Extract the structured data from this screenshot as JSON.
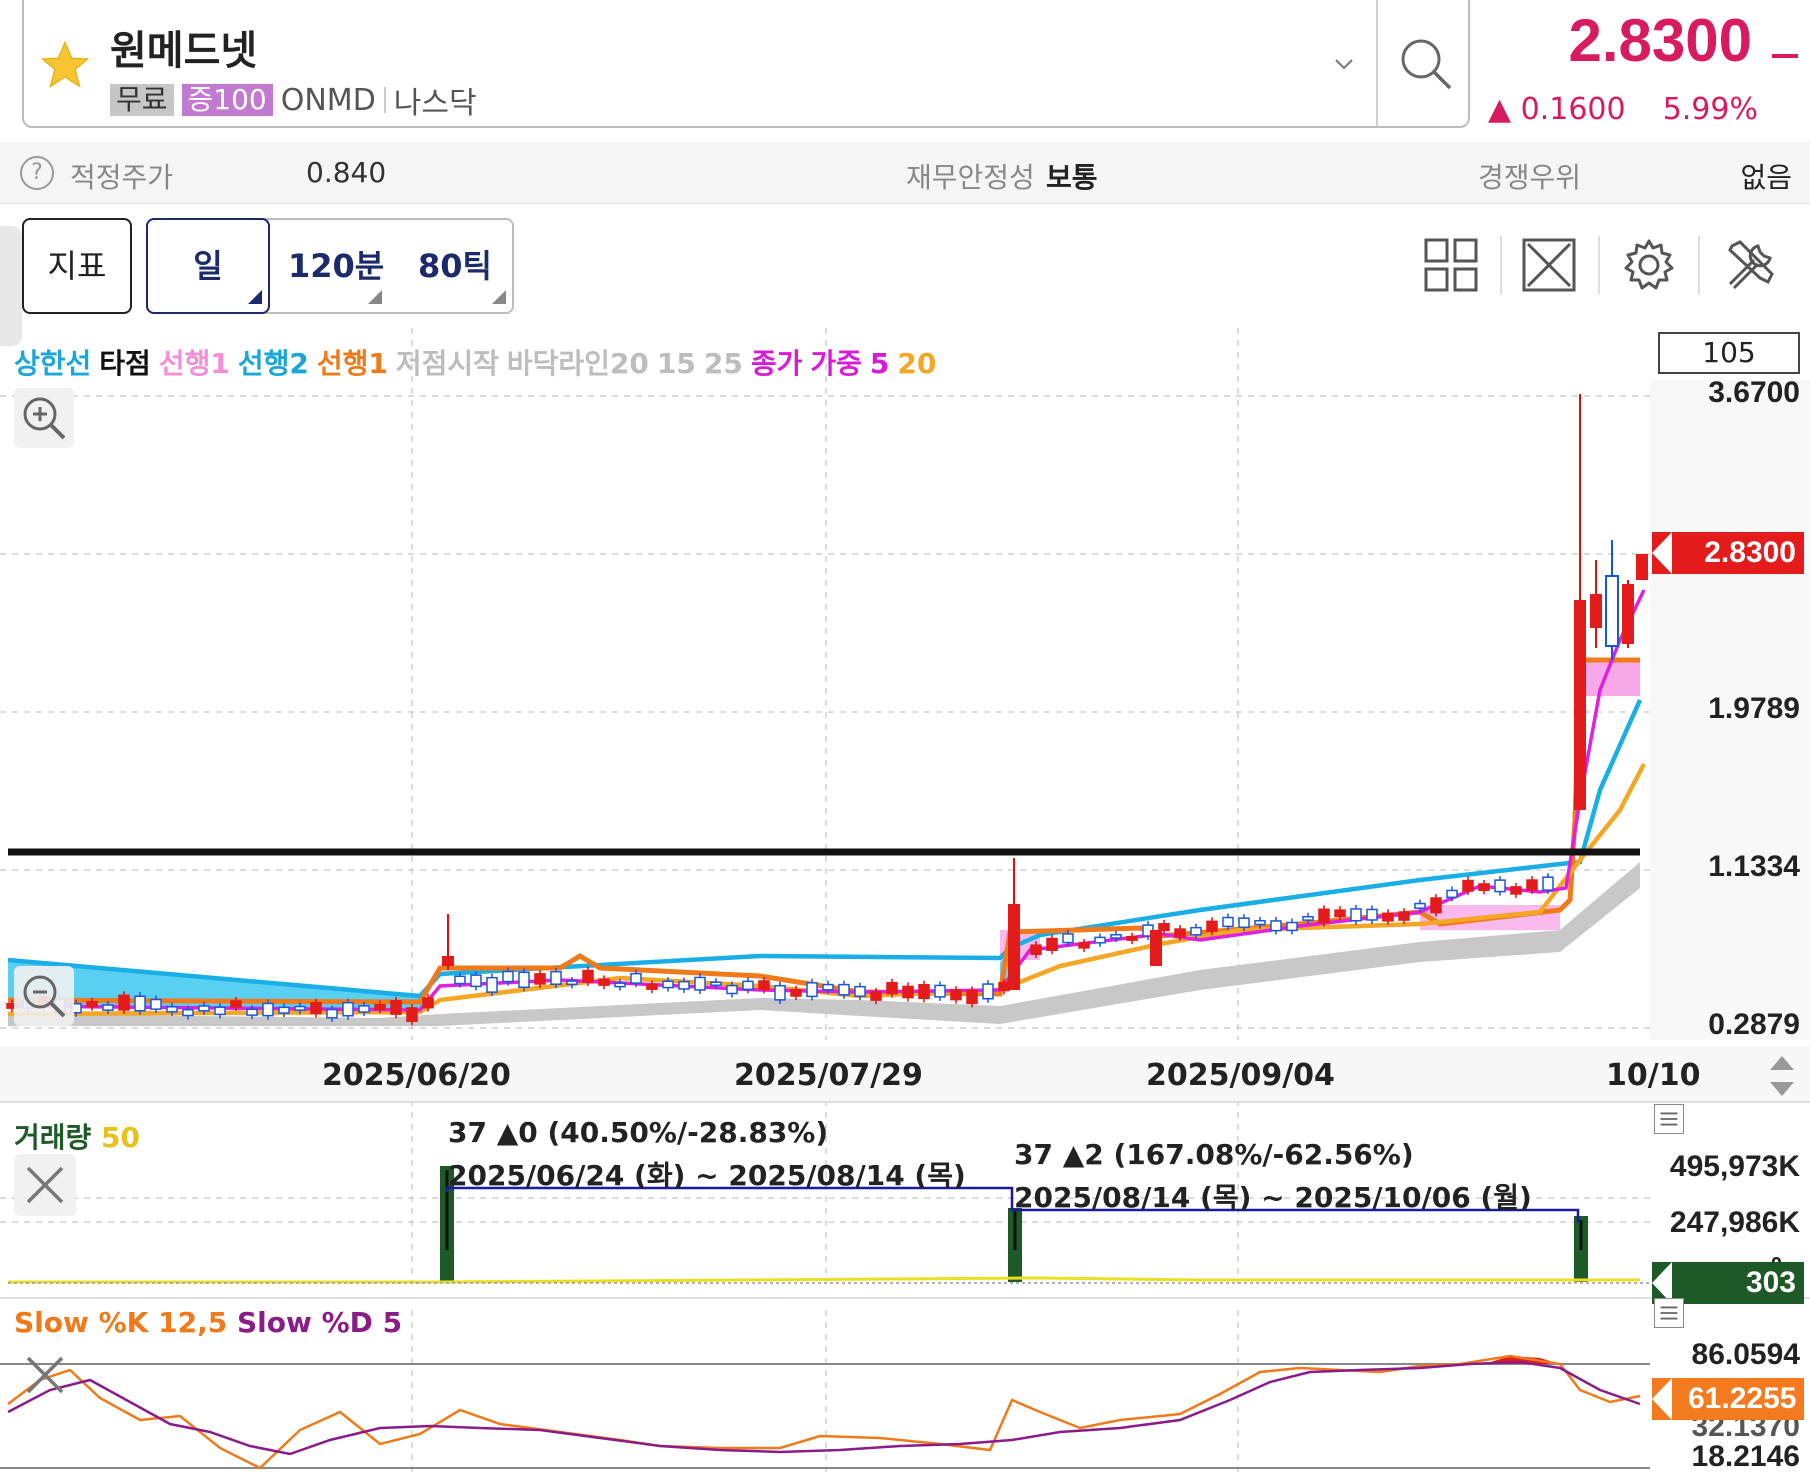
{
  "header": {
    "stock_name": "원메드넷",
    "tag_free": "무료",
    "tag_margin": "증100",
    "ticker": "ONMD",
    "market": "나스닥",
    "price": "2.8300",
    "change": "0.1600",
    "change_pct": "5.99%",
    "accent": "#d81b60"
  },
  "info": {
    "help": "?",
    "fair_price_label": "적정주가",
    "fair_price_value": "0.840",
    "stability_label": "재무안정성",
    "stability_value": "보통",
    "competition_label": "경쟁우위",
    "competition_value": "없음"
  },
  "toolbar": {
    "indicator_label": "지표",
    "timeframes": [
      "일",
      "120분",
      "80틱"
    ],
    "icons": [
      "layout-grid-icon",
      "fullscreen-icon",
      "settings-icon",
      "tools-icon"
    ]
  },
  "chart": {
    "legend": [
      {
        "text": "상한선",
        "color": "#1aa7d6"
      },
      {
        "text": "타점",
        "color": "#111111"
      },
      {
        "text": "선행1",
        "color": "#f48fd6"
      },
      {
        "text": "선행2",
        "color": "#1aa7d6"
      },
      {
        "text": "선행1",
        "color": "#f07a1a"
      },
      {
        "text": "저점시작",
        "color": "#bdbdbd"
      },
      {
        "text": "바닥라인20",
        "color": "#bdbdbd"
      },
      {
        "text": "15",
        "color": "#bdbdbd"
      },
      {
        "text": "25",
        "color": "#bdbdbd"
      },
      {
        "text": "종가",
        "color": "#d81bd8"
      },
      {
        "text": "가중",
        "color": "#d81bd8"
      },
      {
        "text": "5",
        "color": "#d81bd8"
      },
      {
        "text": "20",
        "color": "#f5a623"
      }
    ],
    "bar_count": "105",
    "y_ticks": [
      "3.6700",
      "1.9789",
      "1.1334",
      "0.2879"
    ],
    "current_price": "2.8300",
    "dates": [
      "2025/06/20",
      "2025/07/29",
      "2025/09/04",
      "10/10"
    ]
  },
  "volume": {
    "label": "거래량",
    "period": "50",
    "y_ticks": [
      "495,973K",
      "247,986K",
      "0"
    ],
    "current": "303",
    "annotations": [
      {
        "line1": "37 ▲0 (40.50%/-28.83%)",
        "line2": "2025/06/24 (화) ~ 2025/08/14 (목)"
      },
      {
        "line1": "37 ▲2 (167.08%/-62.56%)",
        "line2": "2025/08/14 (목) ~ 2025/10/06 (월)"
      }
    ]
  },
  "stochastic": {
    "k_label": "Slow %K 12,5",
    "d_label": "Slow %D 5",
    "y_ticks": [
      "86.0594",
      "32.1370",
      "18.2146"
    ],
    "current": "61.2255"
  }
}
